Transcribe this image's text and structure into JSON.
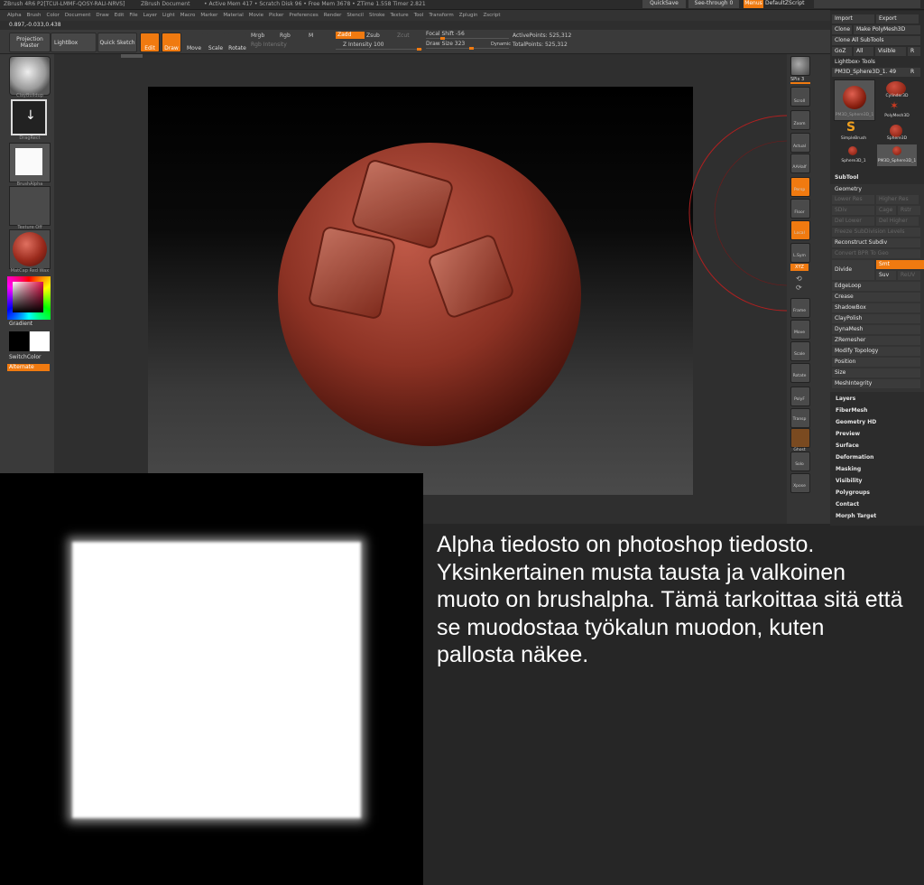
{
  "titlebar": {
    "title": "ZBrush 4R6 P2[TCUI-LMMF-QOSY-RALI-NRVS]",
    "doc": "ZBrush Document",
    "stats": "• Active Mem 417 • Scratch Disk 96 • Free Mem 3678 • ZTime 1.558 Timer 2.821",
    "quicksave": "QuickSave",
    "seethrough": "See-through 0",
    "menus": "Menus",
    "script": "DefaultZScript"
  },
  "menubar": [
    "Alpha",
    "Brush",
    "Color",
    "Document",
    "Draw",
    "Edit",
    "File",
    "Layer",
    "Light",
    "Macro",
    "Marker",
    "Material",
    "Movie",
    "Picker",
    "Preferences",
    "Render",
    "Stencil",
    "Stroke",
    "Texture",
    "Tool",
    "Transform",
    "Zplugin",
    "Zscript"
  ],
  "coords": "0.897,-0.033,0.438",
  "toolbar": {
    "projection": "Projection Master",
    "lightbox": "LightBox",
    "quicksketch": "Quick Sketch",
    "edit": "Edit",
    "draw": "Draw",
    "move": "Move",
    "scale": "Scale",
    "rotate": "Rotate",
    "mrgb": "Mrgb",
    "rgb": "Rgb",
    "m": "M",
    "rgb_intensity": "Rgb Intensity",
    "zadd": "Zadd",
    "zsub": "Zsub",
    "zcut": "Zcut",
    "z_intensity": "Z Intensity 100",
    "focal_shift": "Focal Shift -56",
    "draw_size": "Draw Size 323",
    "dynamic": "Dynamic",
    "active_points": "ActivePoints: 525,312",
    "total_points": "TotalPoints: 525,312"
  },
  "leftshelf": {
    "brush": "ClayBuildup",
    "stroke": "DragRect",
    "alpha": "BrushAlpha",
    "texture": "Texture Off",
    "material": "MatCap Red Wax",
    "gradient": "Gradient",
    "switchcolor": "SwitchColor",
    "alternate": "Alternate"
  },
  "rightshelf": [
    "BPR",
    "SPix 3",
    "Scroll",
    "Zoom",
    "Actual",
    "AAHalf",
    "Persp",
    "Floor",
    "Local",
    "L.Sym",
    "XYZ",
    "",
    "",
    "Frame",
    "Move",
    "Scale",
    "Rotate",
    "PolyF",
    "Transp",
    "Ghost",
    "Solo",
    "Xpose"
  ],
  "toolpanel": {
    "import": "Import",
    "export": "Export",
    "clone": "Clone",
    "make_polymesh": "Make PolyMesh3D",
    "clone_all": "Clone All SubTools",
    "goz": "GoZ",
    "all": "All",
    "visible": "Visible",
    "r": "R",
    "lightbox_tools": "Lightbox› Tools",
    "current_tool": "PM3D_Sphere3D_1. 49",
    "tools": [
      "PM3D_Sphere3D_1",
      "Cylinder3D",
      "PolyMesh3D",
      "SimpleBrush",
      "Sphere3D",
      "Sphere3D_1",
      "PM3D_Sphere3D_1"
    ],
    "subtool": "SubTool",
    "geometry": "Geometry",
    "lower_res": "Lower Res",
    "higher_res": "Higher Res",
    "sdiv": "SDiv",
    "cage": "Cage",
    "rstr": "Rstr",
    "del_lower": "Del Lower",
    "del_higher": "Del Higher",
    "freeze": "Freeze SubDivision Levels",
    "reconstruct": "Reconstruct Subdiv",
    "convert_bpr": "Convert BPR To Geo",
    "divide": "Divide",
    "smt": "Smt",
    "suv": "Suv",
    "reuv": "ReUV",
    "geometry_items": [
      "EdgeLoop",
      "Crease",
      "ShadowBox",
      "ClayPolish",
      "DynaMesh",
      "ZRemesher",
      "Modify Topology",
      "Position",
      "Size",
      "MeshIntegrity"
    ],
    "sections": [
      "Layers",
      "FiberMesh",
      "Geometry HD",
      "Preview",
      "Surface",
      "Deformation",
      "Masking",
      "Visibility",
      "Polygroups",
      "Contact",
      "Morph Target"
    ]
  },
  "caption": "Alpha tiedosto on photoshop tiedosto. Yksinkertainen musta tausta ja valkoinen muoto on brushalpha. Tämä tarkoittaa sitä että se muodostaa työkalun muodon, kuten pallosta näkee."
}
